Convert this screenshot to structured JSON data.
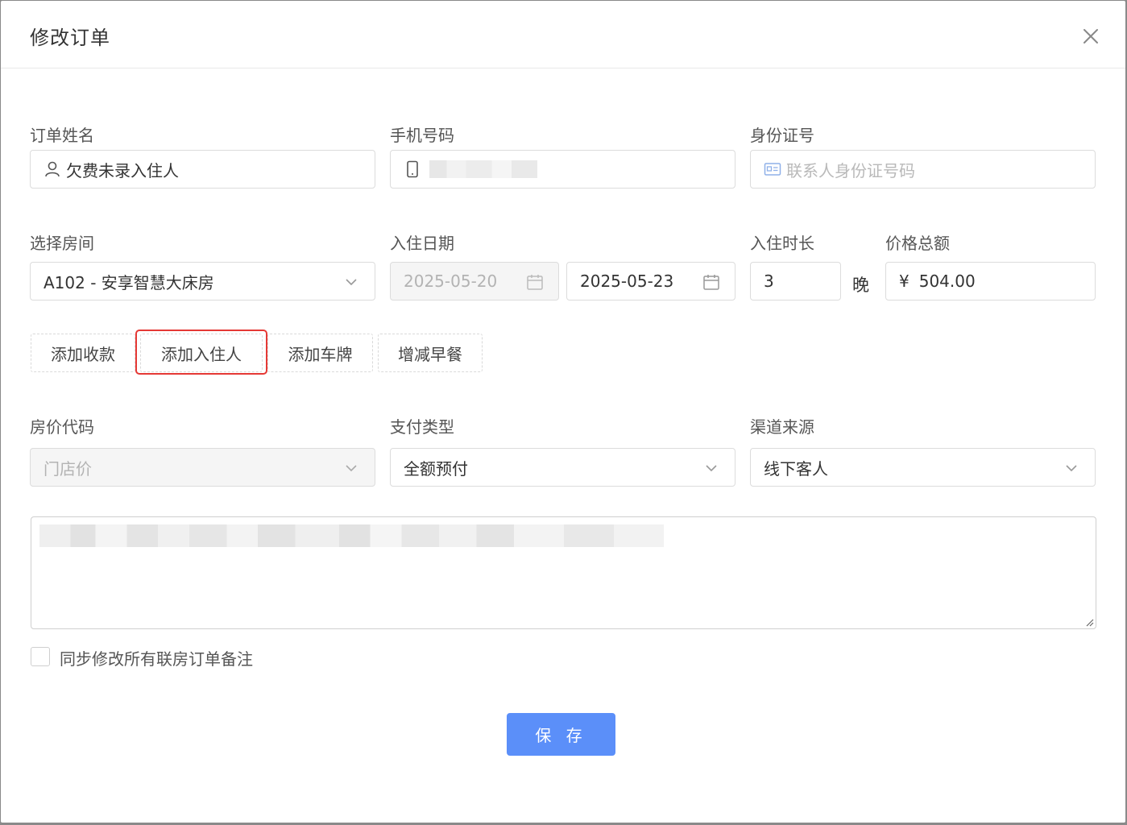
{
  "dialog": {
    "title": "修改订单"
  },
  "form": {
    "order_name": {
      "label": "订单姓名",
      "value": "欠费未录入住人"
    },
    "phone": {
      "label": "手机号码",
      "value": ""
    },
    "id_number": {
      "label": "身份证号",
      "placeholder": "联系人身份证号码"
    },
    "room": {
      "label": "选择房间",
      "value": "A102 - 安享智慧大床房"
    },
    "checkin": {
      "label": "入住日期",
      "start": "2025-05-20",
      "end": "2025-05-23"
    },
    "duration": {
      "label": "入住时长",
      "value": "3",
      "unit": "晚"
    },
    "price": {
      "label": "价格总额",
      "currency": "¥",
      "value": "504.00"
    },
    "actions": [
      "添加收款",
      "添加入住人",
      "添加车牌",
      "增减早餐"
    ],
    "rate_code": {
      "label": "房价代码",
      "value": "门店价"
    },
    "payment_type": {
      "label": "支付类型",
      "value": "全额预付"
    },
    "channel": {
      "label": "渠道来源",
      "value": "线下客人"
    },
    "remark": {
      "value": ""
    },
    "sync_checkbox": {
      "label": "同步修改所有联房订单备注",
      "checked": false
    }
  },
  "footer": {
    "save_label": "保 存"
  },
  "colors": {
    "primary": "#5b8ff9",
    "highlight": "#e53935"
  }
}
